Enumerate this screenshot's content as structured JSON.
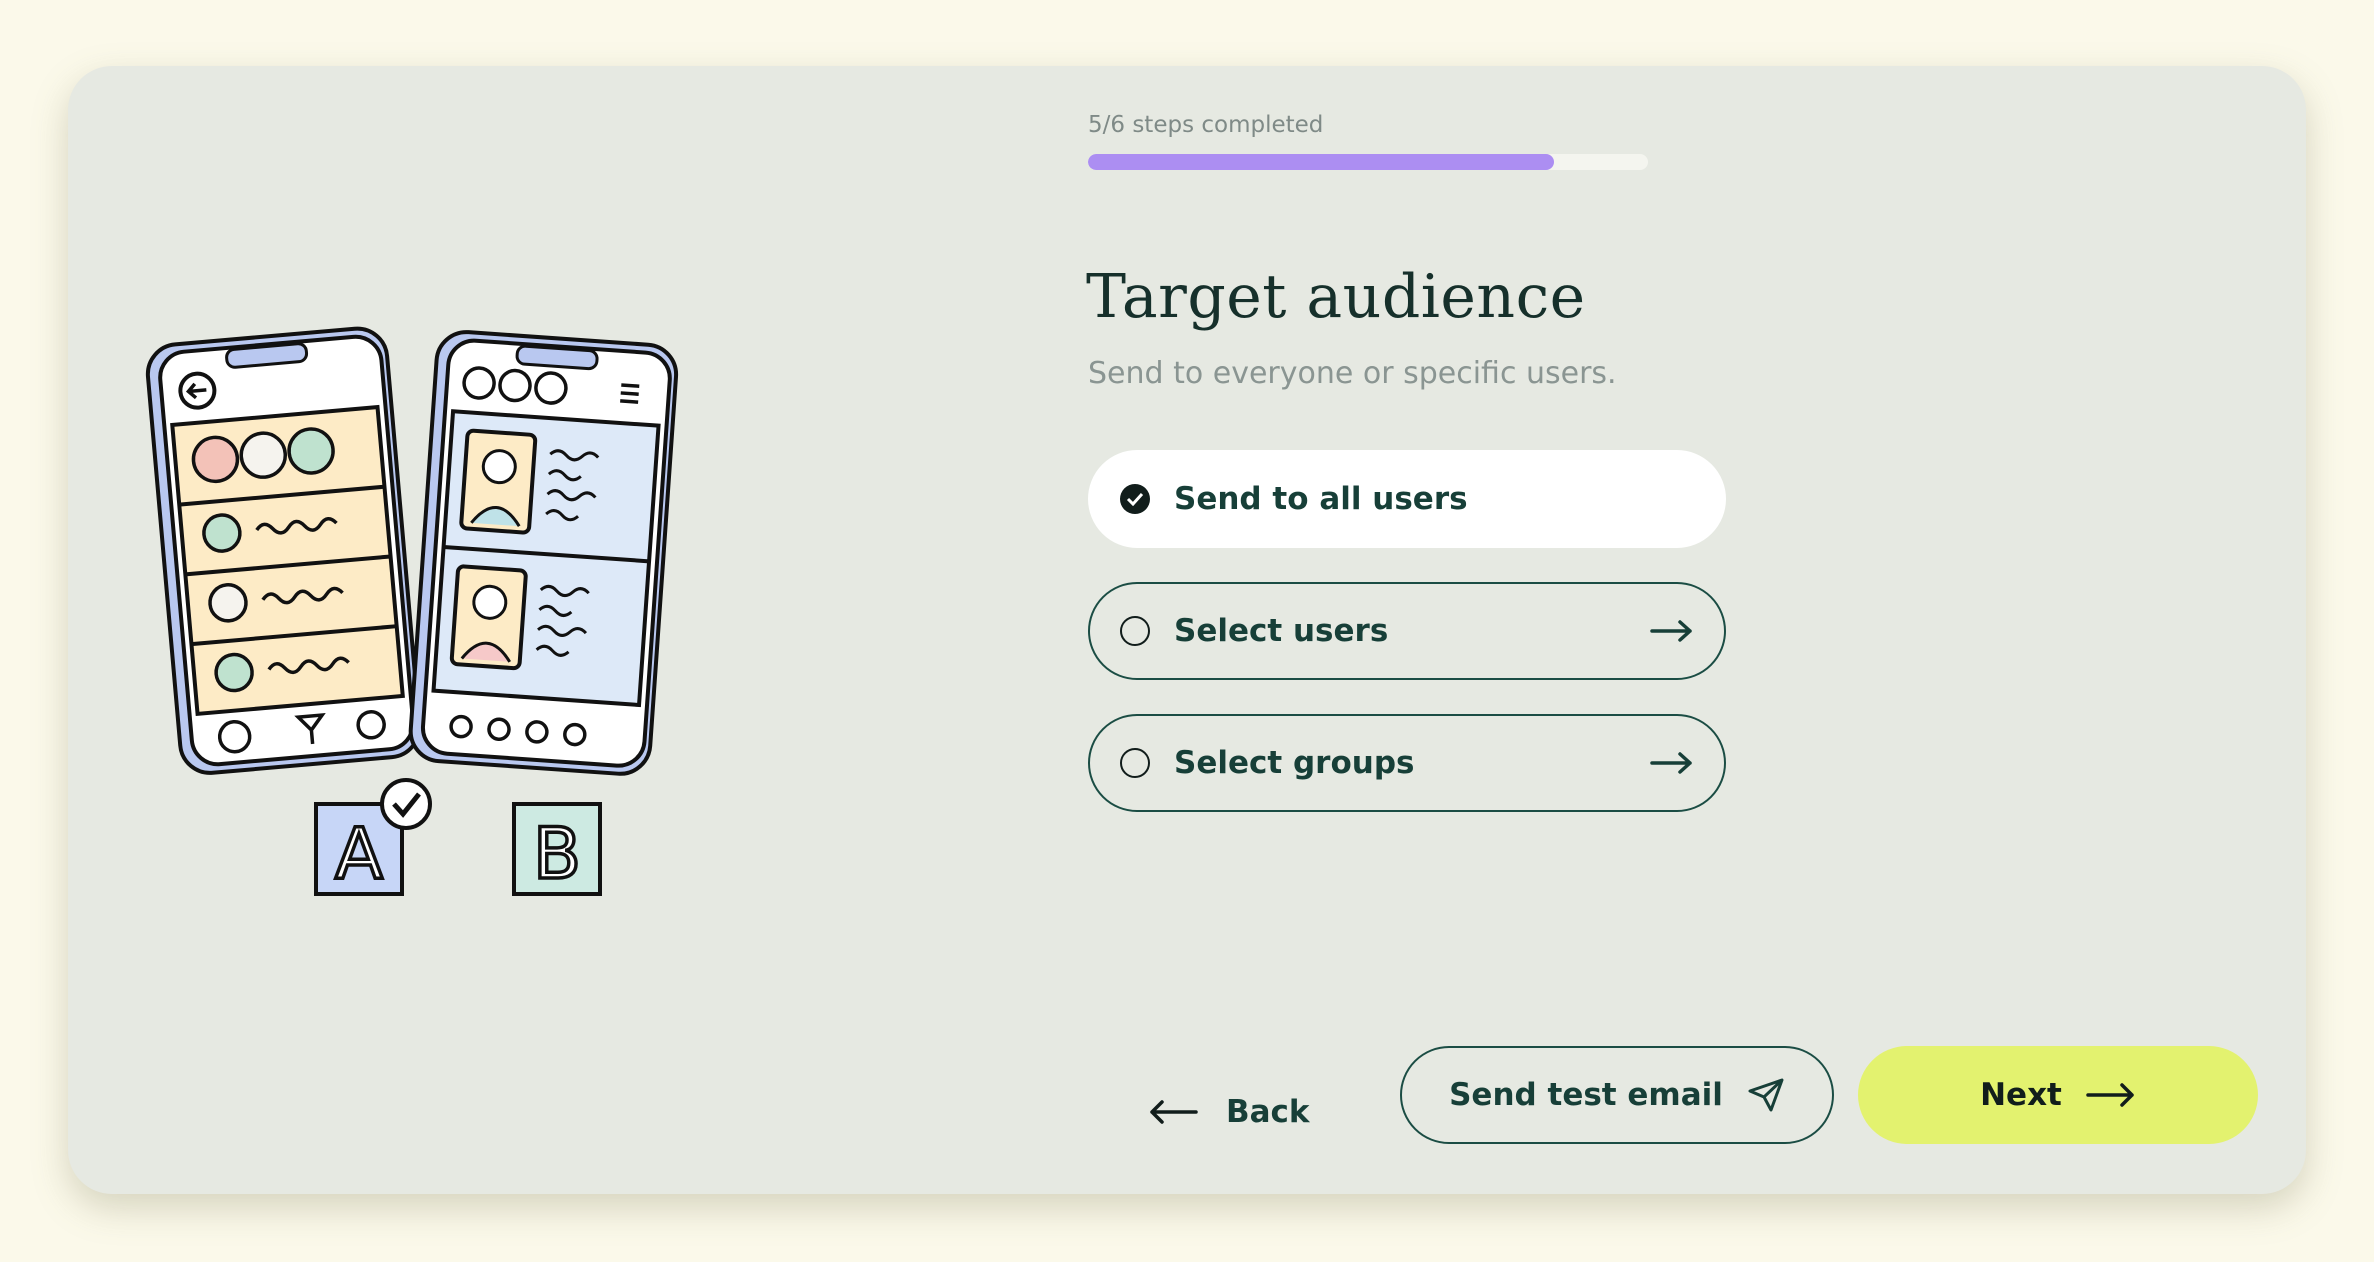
{
  "progress": {
    "label": "5/6 steps completed",
    "fraction": 0.833,
    "fill_color": "#ac8ef2"
  },
  "header": {
    "title": "Target audience",
    "subtitle": "Send to everyone or specific users."
  },
  "options": [
    {
      "label": "Send to all users",
      "selected": true,
      "icon": "check-circle-icon"
    },
    {
      "label": "Select users",
      "selected": false,
      "icon": "arrow-right-icon"
    },
    {
      "label": "Select groups",
      "selected": false,
      "icon": "arrow-right-icon"
    }
  ],
  "illustration": {
    "variant_a_label": "A",
    "variant_b_label": "B"
  },
  "footer": {
    "back_label": "Back",
    "test_email_label": "Send test email",
    "next_label": "Next"
  },
  "colors": {
    "background": "#fbf9ea",
    "card": "#e6e9e2",
    "accent_next": "#e3f26f",
    "text_dark": "#173f38",
    "progress": "#ac8ef2"
  }
}
